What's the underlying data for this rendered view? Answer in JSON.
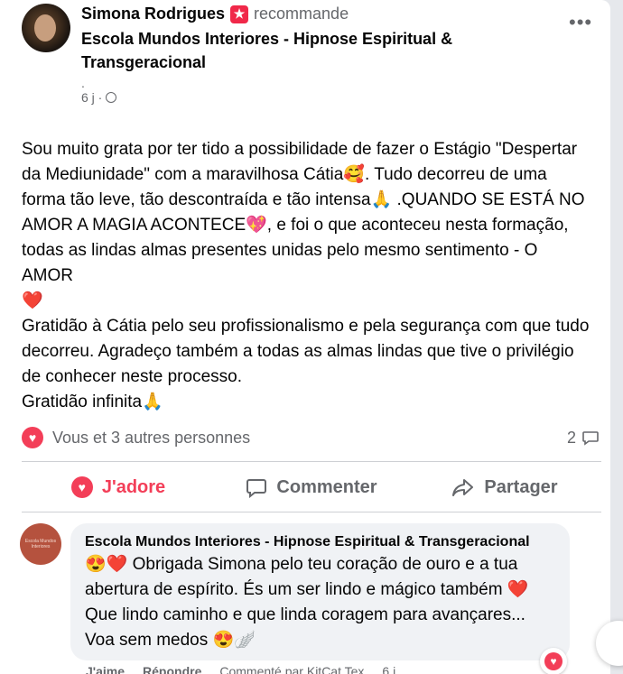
{
  "post": {
    "author": "Simona Rodrigues",
    "action": "recommande",
    "page": "Escola Mundos Interiores - Hipnose Espiritual & Transgeracional",
    "dot": ".",
    "time": "6 j ·",
    "more": "•••",
    "paragraphs": [
      "Sou muito grata por ter tido a possibilidade de fazer o Estágio \"Despertar da Mediunidade\" com a maravilhosa Cátia🥰. Tudo decorreu de uma forma tão leve, tão descontraída e tão intensa🙏 .QUANDO SE ESTÁ NO AMOR A MAGIA ACONTECE💖, e foi o que aconteceu nesta formação, todas as lindas almas presentes unidas pelo mesmo sentimento - O AMOR",
      "❤️",
      "Gratidão à Cátia pelo seu profissionalismo e pela segurança com que tudo decorreu. Agradeço também a todas as almas lindas que tive o privilégio de conhecer neste processo.",
      "Gratidão infinita🙏"
    ]
  },
  "reactions": {
    "text": "Vous et 3 autres personnes",
    "comments": "2"
  },
  "actions": {
    "like": "J'adore",
    "comment": "Commenter",
    "share": "Partager"
  },
  "comment": {
    "avatar_text": "Escola Mundos Interiores",
    "author": "Escola Mundos Interiores - Hipnose Espiritual & Transgeracional",
    "text": "😍❤️ Obrigada Simona pelo teu coração de ouro e a tua abertura de espírito. És um ser lindo e mágico também ❤️ Que lindo caminho e que linda coragem para avançares... Voa sem medos 😍🪽",
    "footer": {
      "like": "J'aime",
      "reply": "Répondre",
      "by": "Commenté par KitCat Tex",
      "time": "6 j"
    }
  },
  "colors": {
    "accent": "#f33e58",
    "muted": "#65676b"
  },
  "icons": [
    "more-icon",
    "globe-icon",
    "heart-icon",
    "comment-icon",
    "share-icon",
    "badge-icon"
  ]
}
